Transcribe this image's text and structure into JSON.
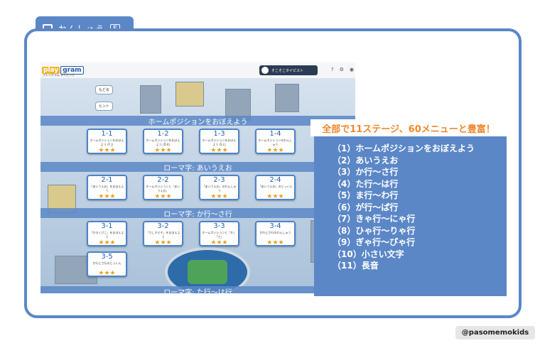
{
  "tab": {
    "label": "れんしゅう",
    "key": "F"
  },
  "app": {
    "logo_main": "play",
    "logo_sub": "gram",
    "logo_caption": "プレイグラム タイピング",
    "user": "そこそこタイピスト",
    "icons": [
      "help-icon",
      "gear-icon",
      "user-icon"
    ]
  },
  "side_buttons": {
    "back": "もどる",
    "hint": "ヒント"
  },
  "sections": [
    {
      "title": "ホームポジションをおぼえよう"
    },
    {
      "title": "ローマ字: あいうえお"
    },
    {
      "title": "ローマ字: か行〜さ行"
    },
    {
      "title": "ローマ字: た行〜は行"
    }
  ],
  "cards": [
    {
      "num": "1-1",
      "title": "ホームポジションをおぼえよう (F J)",
      "stars": "★★★"
    },
    {
      "num": "1-2",
      "title": "ホームポジションをおぼえよう (D K)",
      "stars": "★★★"
    },
    {
      "num": "1-3",
      "title": "ホームポジションをおぼえよう (S L)",
      "stars": "★★★"
    },
    {
      "num": "1-4",
      "title": "ホームポジションのれんしゅう",
      "stars": "★★★"
    },
    {
      "num": "2-1",
      "title": "「あいうえお」をおぼえよう",
      "stars": "★★★"
    },
    {
      "num": "2-2",
      "title": "ホームポジションと「あいうえお」",
      "stars": "★★★"
    },
    {
      "num": "2-3",
      "title": "「あいうえお」のれんしゅう",
      "stars": "★★★"
    },
    {
      "num": "2-4",
      "title": "「あいうえお」のとっくん",
      "stars": "★★★"
    },
    {
      "num": "3-1",
      "title": "「かきくけこ」をおぼえよう",
      "stars": "★★★"
    },
    {
      "num": "3-2",
      "title": "「さしすせそ」をおぼえよう",
      "stars": "★★★"
    },
    {
      "num": "3-3",
      "title": "ホームポジションと「か」「さ」",
      "stars": "★★★"
    },
    {
      "num": "3-4",
      "title": "か行とさ行のれんしゅう",
      "stars": "★★★"
    },
    {
      "num": "3-5",
      "title": "か行とさ行のとっくん",
      "stars": "★★★"
    }
  ],
  "headline": "全部で11ステージ、60メニューと豊富！",
  "menu": [
    "（1）ホームポジションをおぼえよう",
    "（2）あいうえお",
    "（3）か行〜さ行",
    "（4）た行〜は行",
    "（5）ま行〜わ行",
    "（6）が行〜ぱ行",
    "（7）きゃ行〜にゃ行",
    "（8）ひゃ行〜りゃ行",
    "（9）ぎゃ行〜ぴゃ行",
    "（10）小さい文字",
    "（11）長音"
  ],
  "credit": "@pasomemokids",
  "colors": {
    "accent": "#5b87c7",
    "headline": "#f2872c",
    "star": "#e8a21e"
  }
}
